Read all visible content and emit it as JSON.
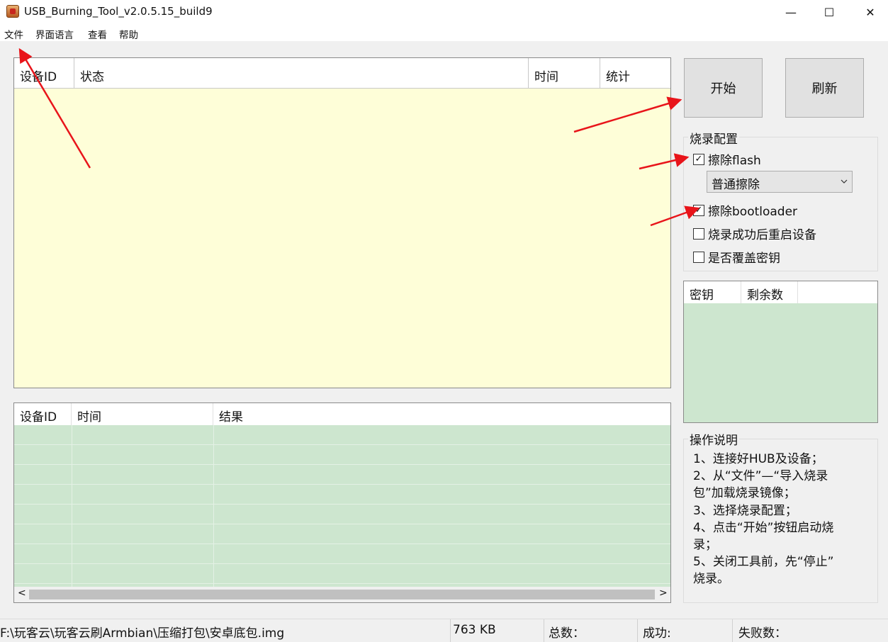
{
  "window": {
    "title": "USB_Burning_Tool_v2.0.5.15_build9",
    "minimize_glyph": "—",
    "maximize_glyph": "☐",
    "close_glyph": "✕"
  },
  "menu": [
    "文件",
    "界面语言",
    "查看",
    "帮助"
  ],
  "device_list": {
    "headers": [
      "设备ID",
      "状态",
      "时间",
      "统计"
    ]
  },
  "result_list": {
    "headers": [
      "设备ID",
      "时间",
      "结果"
    ],
    "scroll_left": "<",
    "scroll_right": ">"
  },
  "buttons": {
    "start": "开始",
    "refresh": "刷新"
  },
  "burn_config": {
    "title": "烧录配置",
    "erase_flash": {
      "label": "擦除flash",
      "checked": true
    },
    "erase_mode": "普通擦除",
    "erase_bootloader": {
      "label": "擦除bootloader",
      "checked": true
    },
    "reboot_after": {
      "label": "烧录成功后重启设备",
      "checked": false
    },
    "overwrite_key": {
      "label": "是否覆盖密钥",
      "checked": false
    }
  },
  "key_list": {
    "headers": [
      "密钥",
      "剩余数"
    ]
  },
  "instructions": {
    "title": "操作说明",
    "lines": [
      "1、连接好HUB及设备；",
      "2、从“文件”—“导入烧录",
      "包”加载烧录镜像；",
      "3、选择烧录配置；",
      "4、点击“开始”按钮启动烧",
      "录；",
      "5、关闭工具前，先“停止”",
      "烧录。"
    ]
  },
  "status_bar": {
    "path": "F:\\玩客云\\玩客云刷Armbian\\压缩打包\\安卓底包.img",
    "size": "763 KB",
    "total": "总数：",
    "success": "成功:",
    "failed": "失败数："
  },
  "colors": {
    "device_bg": "#fefed8",
    "result_bg": "#cde6cf",
    "arrow": "#e8141a"
  }
}
